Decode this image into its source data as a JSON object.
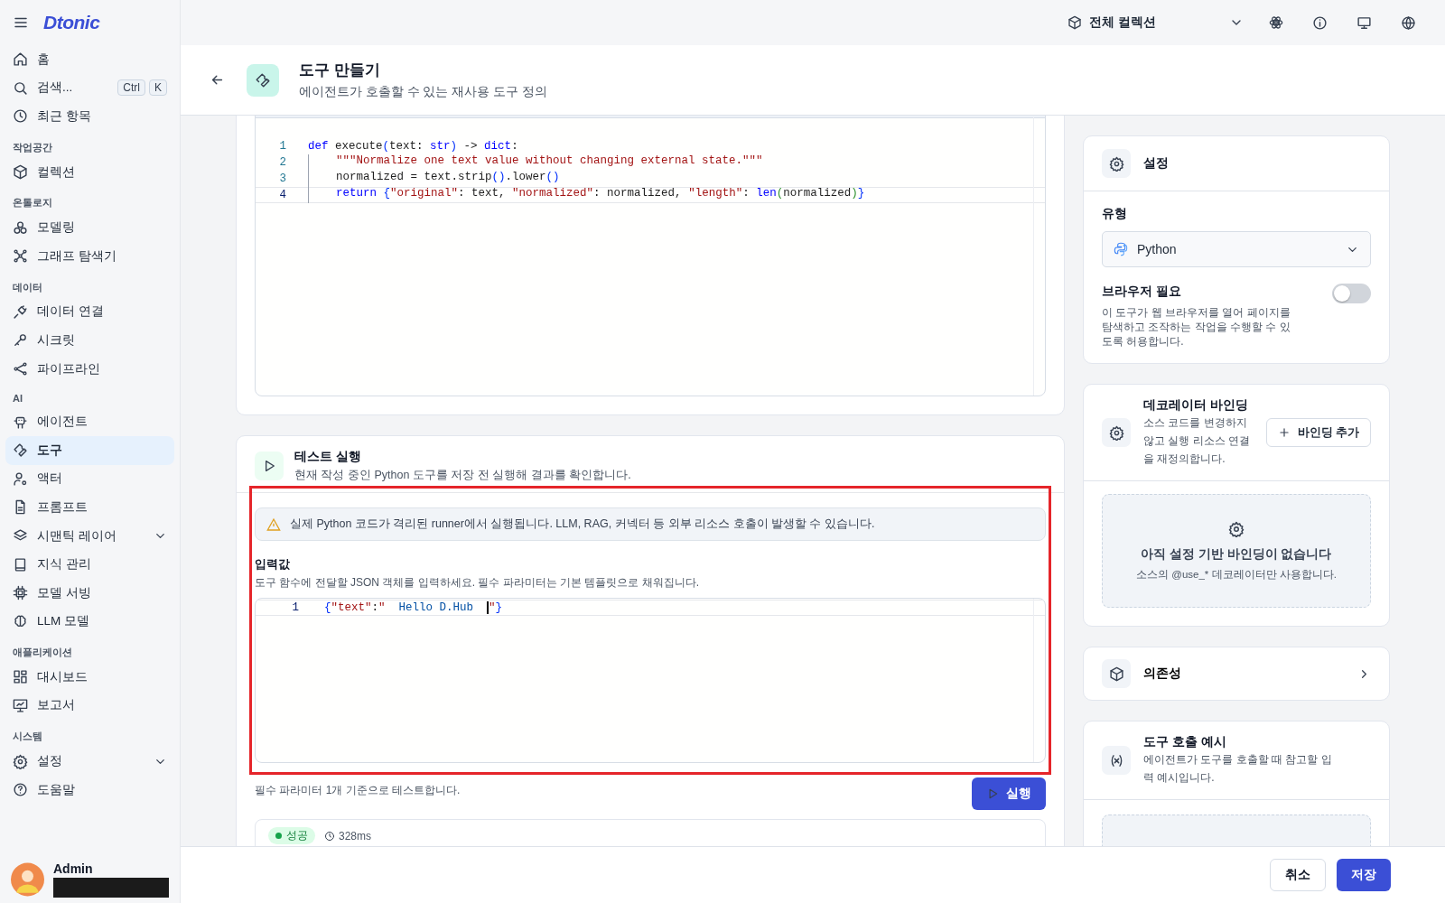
{
  "sidebar": {
    "logo": "Dtonic",
    "items": [
      {
        "kind": "link",
        "label": "홈",
        "selected": false,
        "has_submenu": false
      },
      {
        "kind": "link",
        "label": "검색...",
        "selected": false,
        "has_submenu": false,
        "shortcut": [
          "Ctrl",
          "K"
        ]
      },
      {
        "kind": "link",
        "label": "최근 항목",
        "selected": false,
        "has_submenu": false
      },
      {
        "kind": "section",
        "label": "작업공간"
      },
      {
        "kind": "link",
        "label": "컬렉션",
        "selected": false,
        "has_submenu": false
      },
      {
        "kind": "section",
        "label": "온톨로지"
      },
      {
        "kind": "link",
        "label": "모델링",
        "selected": false,
        "has_submenu": false
      },
      {
        "kind": "link",
        "label": "그래프 탐색기",
        "selected": false,
        "has_submenu": false
      },
      {
        "kind": "section",
        "label": "데이터"
      },
      {
        "kind": "link",
        "label": "데이터 연결",
        "selected": false,
        "has_submenu": false
      },
      {
        "kind": "link",
        "label": "시크릿",
        "selected": false,
        "has_submenu": false
      },
      {
        "kind": "link",
        "label": "파이프라인",
        "selected": false,
        "has_submenu": false
      },
      {
        "kind": "section",
        "label": "AI"
      },
      {
        "kind": "link",
        "label": "에이전트",
        "selected": false,
        "has_submenu": false
      },
      {
        "kind": "link",
        "label": "도구",
        "selected": true,
        "has_submenu": false
      },
      {
        "kind": "link",
        "label": "액터",
        "selected": false,
        "has_submenu": false
      },
      {
        "kind": "link",
        "label": "프롬프트",
        "selected": false,
        "has_submenu": false
      },
      {
        "kind": "link",
        "label": "시맨틱 레이어",
        "selected": false,
        "has_submenu": true
      },
      {
        "kind": "link",
        "label": "지식 관리",
        "selected": false,
        "has_submenu": false
      },
      {
        "kind": "link",
        "label": "모델 서빙",
        "selected": false,
        "has_submenu": false
      },
      {
        "kind": "link",
        "label": "LLM 모델",
        "selected": false,
        "has_submenu": false
      },
      {
        "kind": "section",
        "label": "애플리케이션"
      },
      {
        "kind": "link",
        "label": "대시보드",
        "selected": false,
        "has_submenu": false
      },
      {
        "kind": "link",
        "label": "보고서",
        "selected": false,
        "has_submenu": false
      },
      {
        "kind": "section",
        "label": "시스템"
      },
      {
        "kind": "link",
        "label": "설정",
        "selected": false,
        "has_submenu": true
      },
      {
        "kind": "link",
        "label": "도움말",
        "selected": false,
        "has_submenu": false
      }
    ],
    "user": {
      "name": "Admin"
    }
  },
  "topbar": {
    "collection": "전체 컬렉션"
  },
  "page_header": {
    "title": "도구 만들기",
    "subtitle": "에이전트가 호출할 수 있는 재사용 도구 정의"
  },
  "code_editor": {
    "lines": [
      {
        "number": "1",
        "current": false,
        "indented": false,
        "tokens": [
          {
            "kind": "kw",
            "text": "def"
          },
          {
            "kind": "plain",
            "text": " execute"
          },
          {
            "kind": "bracket",
            "text": "("
          },
          {
            "kind": "plain",
            "text": "text: "
          },
          {
            "kind": "kw",
            "text": "str"
          },
          {
            "kind": "bracket",
            "text": ")"
          },
          {
            "kind": "plain",
            "text": " -> "
          },
          {
            "kind": "kw",
            "text": "dict"
          },
          {
            "kind": "plain",
            "text": ":"
          }
        ]
      },
      {
        "number": "2",
        "current": false,
        "indented": true,
        "tokens": [
          {
            "kind": "str",
            "text": "\"\"\"Normalize one text value without changing external state.\"\"\""
          }
        ]
      },
      {
        "number": "3",
        "current": false,
        "indented": true,
        "tokens": [
          {
            "kind": "plain",
            "text": "normalized = text.strip"
          },
          {
            "kind": "bracket",
            "text": "()"
          },
          {
            "kind": "plain",
            "text": ".lower"
          },
          {
            "kind": "bracket",
            "text": "()"
          }
        ]
      },
      {
        "number": "4",
        "current": true,
        "indented": true,
        "tokens": [
          {
            "kind": "kw",
            "text": "return"
          },
          {
            "kind": "bracket",
            "text": " {"
          },
          {
            "kind": "str",
            "text": "\"original\""
          },
          {
            "kind": "plain",
            "text": ": text, "
          },
          {
            "kind": "str",
            "text": "\"normalized\""
          },
          {
            "kind": "plain",
            "text": ": normalized, "
          },
          {
            "kind": "str",
            "text": "\"length\""
          },
          {
            "kind": "plain",
            "text": ": "
          },
          {
            "kind": "kw",
            "text": "len"
          },
          {
            "kind": "bracket2",
            "text": "("
          },
          {
            "kind": "plain",
            "text": "normalized"
          },
          {
            "kind": "bracket2",
            "text": ")"
          },
          {
            "kind": "bracket",
            "text": "}"
          }
        ]
      }
    ]
  },
  "test_run": {
    "title": "테스트 실행",
    "subtitle": "현재 작성 중인 Python 도구를 저장 전 실행해 결과를 확인합니다.",
    "warning": "실제 Python 코드가 격리된 runner에서 실행됩니다. LLM, RAG, 커넥터 등 외부 리소스 호출이 발생할 수 있습니다.",
    "input_label": "입력값",
    "input_hint": "도구 함수에 전달할 JSON 객체를 입력하세요. 필수 파라미터는 기본 템플릿으로 채워집니다.",
    "input_lines": [
      {
        "number": "1",
        "current": true,
        "indented": false,
        "tokens": [
          {
            "kind": "bracket",
            "text": "{"
          },
          {
            "kind": "key",
            "text": "\"text\""
          },
          {
            "kind": "plain",
            "text": ":"
          },
          {
            "kind": "key",
            "text": "\""
          },
          {
            "kind": "value",
            "text": "  Hello D.Hub  "
          },
          {
            "kind": "cursor",
            "text": "\""
          },
          {
            "kind": "bracket",
            "text": "}"
          }
        ]
      }
    ],
    "footnote": "필수 파라미터 1개 기준으로 테스트합니다.",
    "run_button": "실행",
    "result": {
      "status": "성공",
      "duration": "328ms"
    }
  },
  "highlight": {
    "shown": true
  },
  "settings": {
    "title": "설정",
    "type_label": "유형",
    "type_value": "Python",
    "browser_label": "브라우저 필요",
    "browser_desc": "이 도구가 웹 브라우저를 열어 페이지를 탐색하고 조작하는 작업을 수행할 수 있도록 허용합니다.",
    "browser_on": false
  },
  "decorator": {
    "title": "데코레이터 바인딩",
    "desc": "소스 코드를 변경하지 않고 실행 리소스 연결을 재정의합니다.",
    "add_button": "바인딩 추가",
    "empty_title": "아직 설정 기반 바인딩이 없습니다",
    "empty_desc": "소스의 @use_* 데코레이터만 사용합니다."
  },
  "dependencies": {
    "title": "의존성"
  },
  "example": {
    "title": "도구 호출 예시",
    "desc": "에이전트가 도구를 호출할 때 참고할 입력 예시입니다."
  },
  "footer": {
    "cancel": "취소",
    "save": "저장"
  }
}
